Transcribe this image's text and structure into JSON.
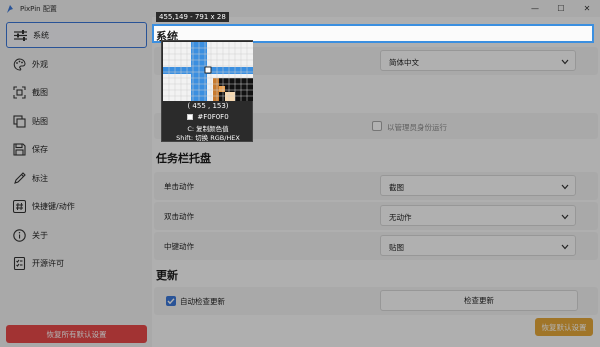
{
  "window": {
    "title": "PixPin 配置",
    "minimize": "—",
    "maximize": "☐",
    "close": "✕"
  },
  "sidebar": {
    "items": [
      {
        "label": "系统",
        "icon": "sliders-icon"
      },
      {
        "label": "外观",
        "icon": "palette-icon"
      },
      {
        "label": "截图",
        "icon": "screenshot-icon"
      },
      {
        "label": "贴图",
        "icon": "pin-image-icon"
      },
      {
        "label": "保存",
        "icon": "save-icon"
      },
      {
        "label": "标注",
        "icon": "pencil-icon"
      },
      {
        "label": "快捷键/动作",
        "icon": "hash-icon"
      },
      {
        "label": "关于",
        "icon": "info-icon"
      },
      {
        "label": "开源许可",
        "icon": "license-icon"
      }
    ],
    "reset_all": "恢复所有默认设置"
  },
  "system": {
    "title": "系统",
    "language_value": "简体中文",
    "admin_checkbox": "以管理员身份运行"
  },
  "tray": {
    "title": "任务栏托盘",
    "rows": [
      {
        "label": "单击动作",
        "value": "截图"
      },
      {
        "label": "双击动作",
        "value": "无动作"
      },
      {
        "label": "中键动作",
        "value": "贴图"
      }
    ]
  },
  "update": {
    "title": "更新",
    "auto_check": "自动检查更新",
    "check_button": "检查更新"
  },
  "reset_default": "恢复默认设置",
  "overlay": {
    "selection_size": "455,149 - 791 x 28",
    "cursor_coord": "( 455 , 153)",
    "hex": "#F0F0F0",
    "copy_hint": "C: 复制颜色值",
    "shift_hint": "Shift: 切换 RGB/HEX"
  },
  "colors": {
    "accent": "#3b78d8",
    "danger": "#e94a4a",
    "warning": "#e6a83a",
    "selection": "#3b8fe0"
  }
}
